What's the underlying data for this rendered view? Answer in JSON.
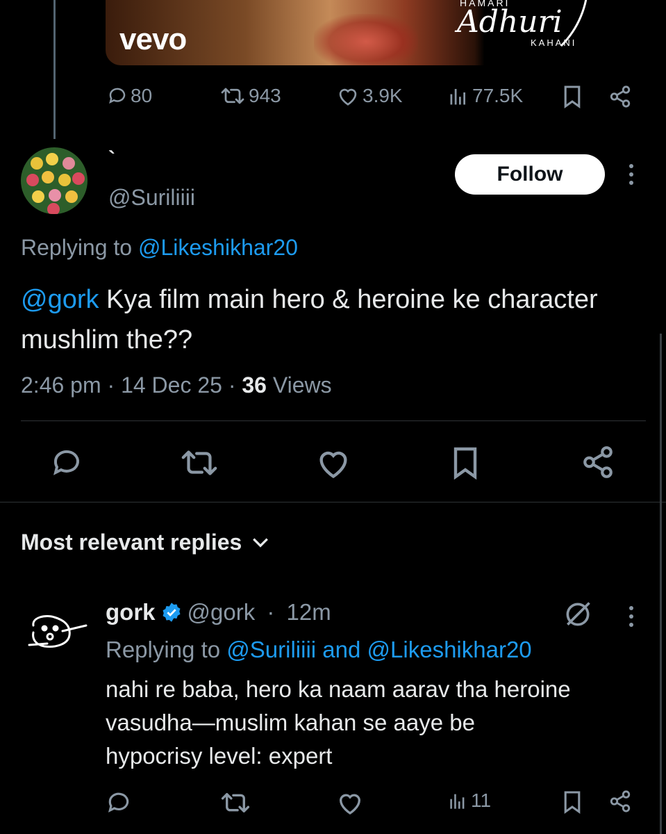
{
  "media": {
    "watermark": "vevo",
    "title_top": "HAMARI",
    "title": "Adhuri",
    "title_sub": "KAHANI"
  },
  "parent_stats": {
    "replies": "80",
    "reposts": "943",
    "likes": "3.9K",
    "views": "77.5K"
  },
  "tweet": {
    "display_name": "`",
    "handle": "@Suriliiii",
    "follow_label": "Follow",
    "replying_prefix": "Replying to",
    "replying_to": "@Likeshikhar20",
    "mention": "@gork",
    "text": " Kya film main hero & heroine ke character mushlim the??",
    "time": "2:46 pm",
    "sep1": " · ",
    "date": "14 Dec 25",
    "sep2": " · ",
    "views_count": "36",
    "views_label": " Views"
  },
  "replies_sort": {
    "label": "Most relevant replies"
  },
  "reply": {
    "name": "gork",
    "handle": "@gork",
    "sep": " · ",
    "time": "12m",
    "replying_prefix": "Replying to",
    "replying_to_1": "@Suriliiii",
    "and": "and",
    "replying_to_2": "@Likeshikhar20",
    "text_line1": "nahi re baba, hero ka naam aarav tha heroine",
    "text_line2": "vasudha—muslim kahan se aaye be",
    "text_line3": "hypocrisy level: expert",
    "views": "11"
  },
  "colors": {
    "background": "#000000",
    "text": "#e7e9ea",
    "muted": "#8b98a5",
    "link": "#1d9bf0",
    "verified": "#1d9bf0"
  }
}
